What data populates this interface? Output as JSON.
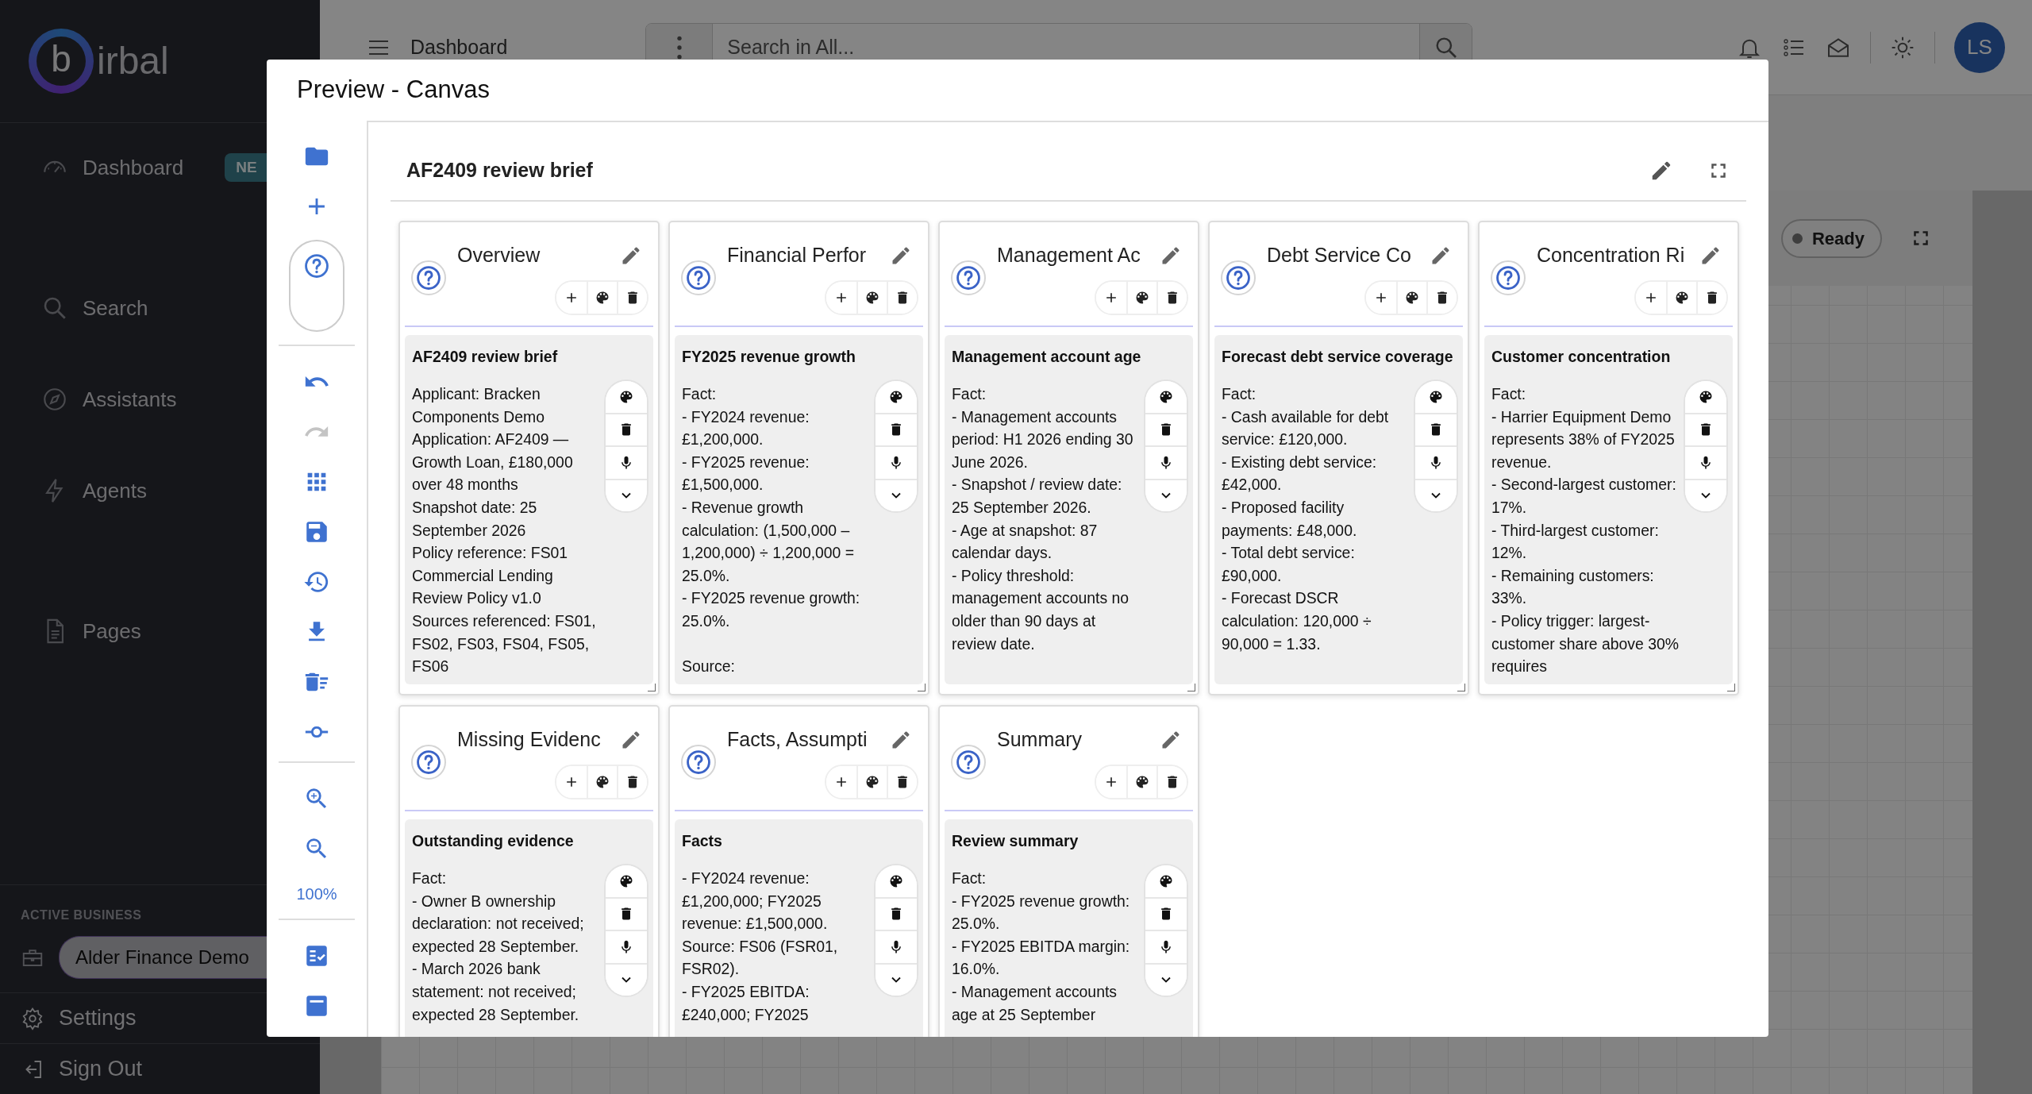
{
  "sidebar": {
    "brand_letter": "b",
    "brand": "irbal",
    "nav": [
      {
        "kind": "dashboard",
        "label": "Dashboard",
        "badge": "NE"
      },
      {
        "kind": "search",
        "label": "Search"
      },
      {
        "kind": "assistants",
        "label": "Assistants"
      },
      {
        "kind": "agents",
        "label": "Agents"
      },
      {
        "kind": "pages",
        "label": "Pages"
      }
    ],
    "active_business_label": "ACTIVE BUSINESS",
    "active_business": "Alder Finance Demo",
    "footer": [
      {
        "kind": "settings",
        "label": "Settings"
      },
      {
        "kind": "signout",
        "label": "Sign Out"
      }
    ]
  },
  "topbar": {
    "title": "Dashboard",
    "search_placeholder": "Search in All...",
    "avatar": "LS"
  },
  "background_panel": {
    "status": "Ready"
  },
  "modal": {
    "title": "Preview - Canvas",
    "toolbar": [
      [
        {
          "kind": "folder",
          "disabled": false
        },
        {
          "kind": "add",
          "disabled": false
        },
        {
          "kind": "help",
          "disabled": false
        }
      ],
      [
        {
          "kind": "undo",
          "disabled": false
        },
        {
          "kind": "redo",
          "disabled": true
        },
        {
          "kind": "grid",
          "disabled": false
        },
        {
          "kind": "save",
          "disabled": false
        },
        {
          "kind": "history",
          "disabled": false
        },
        {
          "kind": "download",
          "disabled": false
        },
        {
          "kind": "clear",
          "disabled": false
        },
        {
          "kind": "commit",
          "disabled": false
        }
      ],
      [
        {
          "kind": "zoom_in",
          "disabled": false
        },
        {
          "kind": "zoom_out",
          "disabled": false
        },
        {
          "kind": "zoom_label",
          "label": "100%"
        }
      ],
      [
        {
          "kind": "checklist",
          "disabled": false
        },
        {
          "kind": "panel",
          "disabled": false
        }
      ]
    ],
    "board": {
      "title": "AF2409 review brief",
      "sections": [
        {
          "title": "Overview",
          "note": {
            "title": "AF2409 review brief",
            "text": "Applicant: Bracken Components Demo\nApplication: AF2409 — Growth Loan, £180,000 over 48 months\nSnapshot date: 25 September 2026\nPolicy reference: FS01 Commercial Lending Review Policy v1.0\nSources referenced: FS01, FS02, FS03, FS04, FS05, FS06"
          }
        },
        {
          "title": "Financial Perfor",
          "note": {
            "title": "FY2025 revenue growth",
            "text": "Fact:\n- FY2024 revenue: £1,200,000.\n- FY2025 revenue: £1,500,000.\n- Revenue growth calculation: (1,500,000 – 1,200,000) ÷ 1,200,000 = 25.0%.\n- FY2025 revenue growth: 25.0%.\n\nSource:"
          }
        },
        {
          "title": "Management Ac",
          "note": {
            "title": "Management account age",
            "text": "Fact:\n- Management accounts period: H1 2026 ending 30 June 2026.\n- Snapshot / review date: 25 September 2026.\n- Age at snapshot: 87 calendar days.\n- Policy threshold: management accounts no older than 90 days at review date."
          }
        },
        {
          "title": "Debt Service Co",
          "note": {
            "title": "Forecast debt service coverage",
            "text": "Fact:\n- Cash available for debt service: £120,000.\n- Existing debt service: £42,000.\n- Proposed facility payments: £48,000.\n- Total debt service: £90,000.\n- Forecast DSCR calculation: 120,000 ÷ 90,000 = 1.33."
          }
        },
        {
          "title": "Concentration Ri",
          "note": {
            "title": "Customer concentration",
            "text": "Fact:\n- Harrier Equipment Demo represents 38% of FY2025 revenue.\n- Second-largest customer: 17%.\n- Third-largest customer: 12%.\n- Remaining customers: 33%.\n- Policy trigger: largest-customer share above 30% requires"
          }
        },
        {
          "title": "Missing Evidenc",
          "note": {
            "title": "Outstanding evidence",
            "text": "Fact:\n- Owner B ownership declaration: not received; expected 28 September.\n- March 2026 bank statement: not received; expected 28 September."
          }
        },
        {
          "title": "Facts, Assumpti",
          "note": {
            "title": "Facts",
            "text": "- FY2024 revenue: £1,200,000; FY2025 revenue: £1,500,000.\nSource: FS06 (FSR01, FSR02).\n- FY2025 EBITDA: £240,000; FY2025"
          }
        },
        {
          "title": "Summary",
          "note": {
            "title": "Review summary",
            "text": "Fact:\n- FY2025 revenue growth: 25.0%.\n- FY2025 EBITDA margin: 16.0%.\n- Management accounts age at 25 September"
          }
        }
      ]
    }
  }
}
